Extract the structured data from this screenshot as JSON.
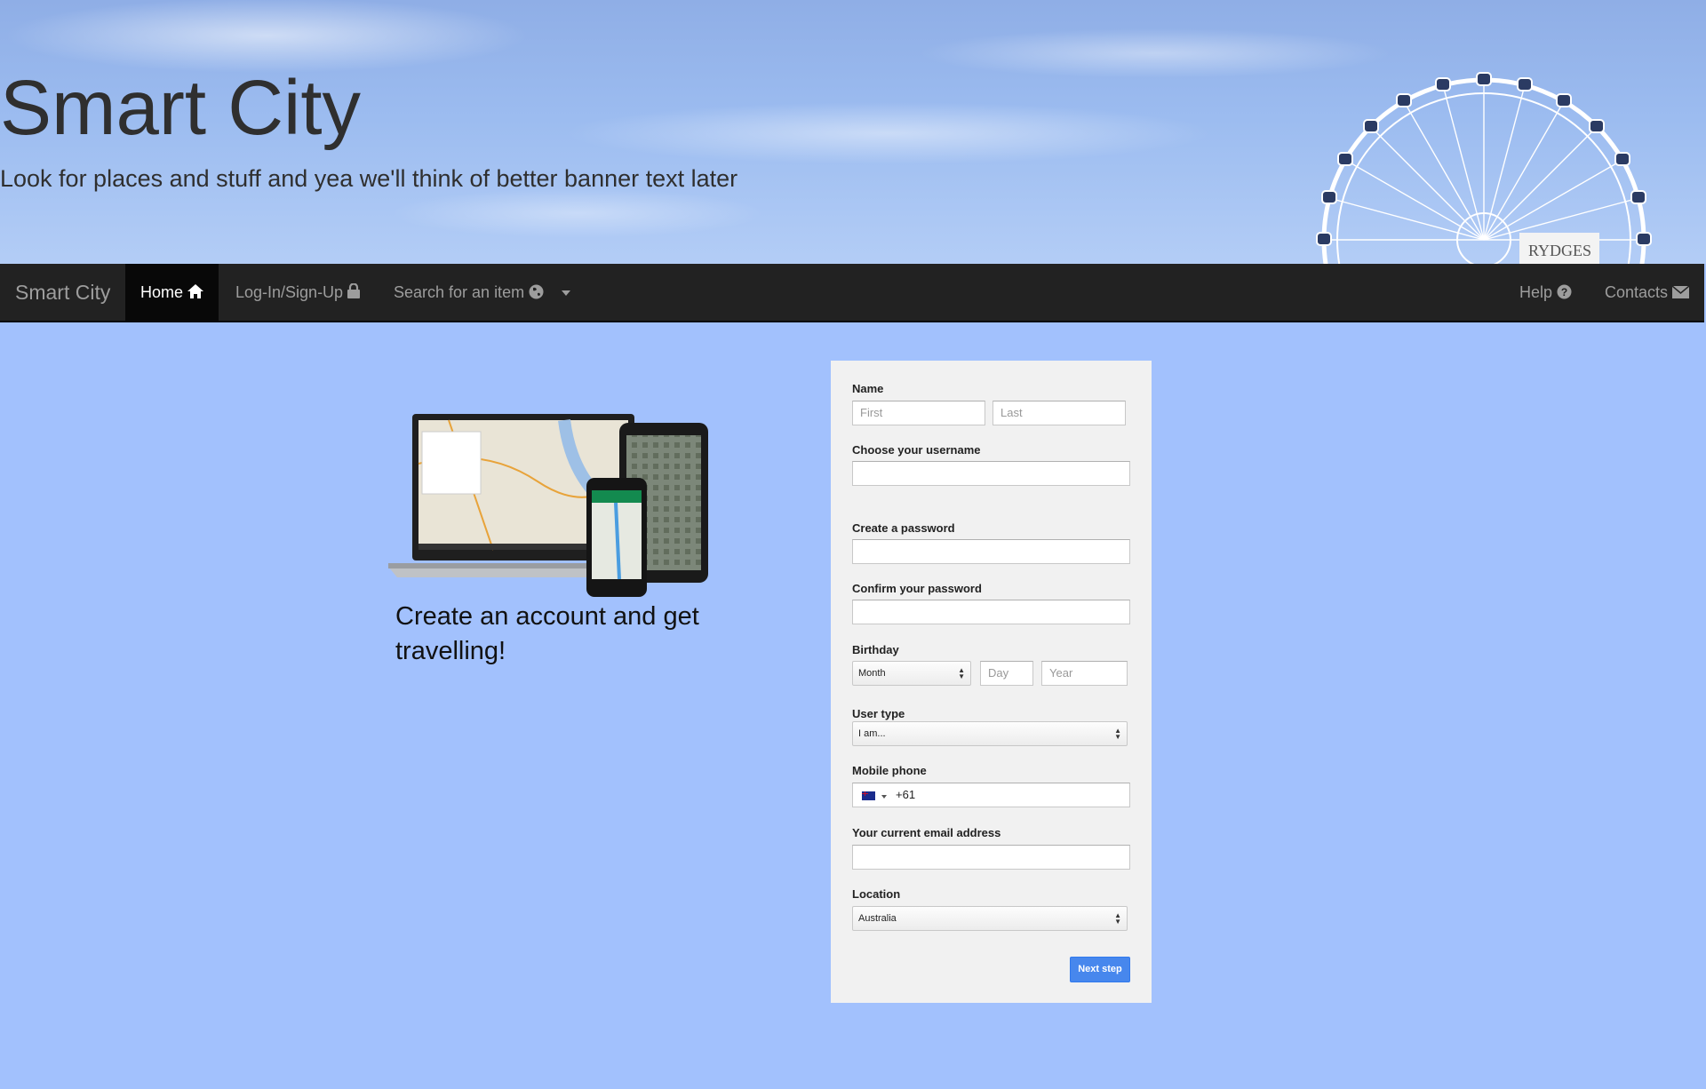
{
  "banner": {
    "title": "Smart City",
    "subtitle": "Look for places and stuff and yea we'll think of better banner text later",
    "sign_text": "RYDGES"
  },
  "navbar": {
    "brand": "Smart City",
    "items": [
      {
        "label": "Home",
        "icon": "home-icon",
        "active": true
      },
      {
        "label": "Log-In/Sign-Up",
        "icon": "lock-icon"
      },
      {
        "label": "Search for an item",
        "icon": "globe-icon",
        "dropdown": true
      }
    ],
    "right_items": [
      {
        "label": "Help",
        "icon": "question-circle-icon"
      },
      {
        "label": "Contacts",
        "icon": "envelope-icon"
      }
    ]
  },
  "promo": {
    "text": "Create an account and get travelling!"
  },
  "form": {
    "name_label": "Name",
    "first_placeholder": "First",
    "last_placeholder": "Last",
    "username_label": "Choose your username",
    "password_label": "Create a password",
    "confirm_label": "Confirm your password",
    "birthday_label": "Birthday",
    "month_value": "Month",
    "day_placeholder": "Day",
    "year_placeholder": "Year",
    "usertype_label": "User type",
    "usertype_value": "I am...",
    "phone_label": "Mobile phone",
    "phone_value": "+61",
    "email_label": "Your current email address",
    "location_label": "Location",
    "location_value": "Australia",
    "next_button": "Next step"
  },
  "colors": {
    "page_bg": "#a2c1fd",
    "navbar_bg": "#222222",
    "panel_bg": "#f1f1f1",
    "button": "#4787ed"
  }
}
